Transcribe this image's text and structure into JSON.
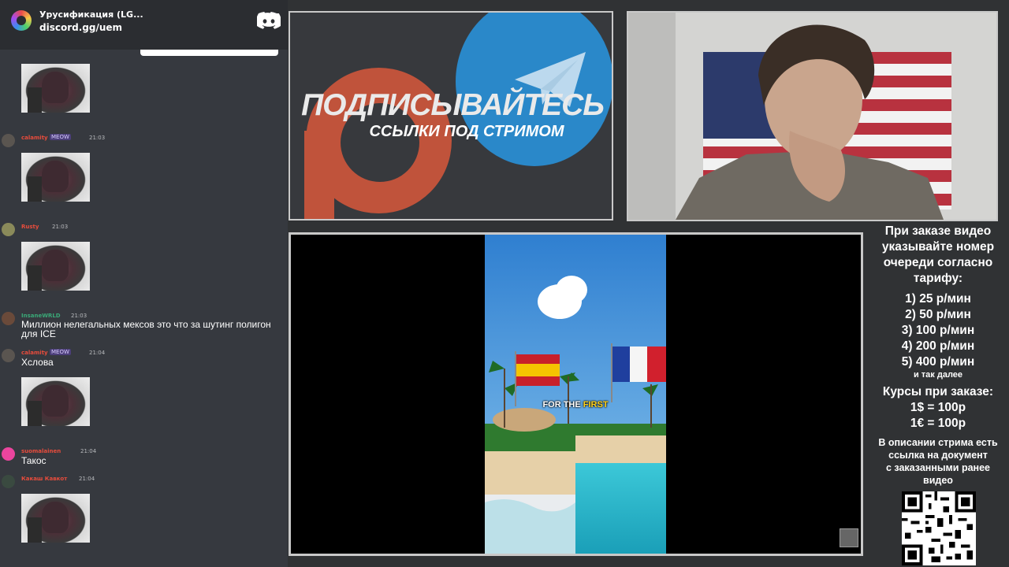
{
  "banner": {
    "title": "Урусификация (LG...",
    "invite": "discord.gg/uem"
  },
  "chat": {
    "messages": [
      {
        "user": "calamity",
        "badge": "MEOW",
        "time": "21:03",
        "text": "",
        "has_image": true,
        "color": "#e74c3c"
      },
      {
        "user": "Rusty",
        "badge": "",
        "time": "21:03",
        "text": "",
        "has_image": true,
        "color": "#e74c3c"
      },
      {
        "user": "InsaneWRLD",
        "badge": "",
        "time": "21:03",
        "text": "Миллион нелегальных мексов это что за шутинг полигон для ICE",
        "has_image": false,
        "color": "#3aa877"
      },
      {
        "user": "calamity",
        "badge": "MEOW",
        "time": "21:04",
        "text": "Хслова",
        "has_image": true,
        "color": "#e74c3c"
      },
      {
        "user": "suomalainen",
        "badge": "",
        "time": "21:04",
        "text": "Такос",
        "has_image": false,
        "color": "#e74c3c"
      },
      {
        "user": "Какаш Кавкот",
        "badge": "",
        "time": "21:04",
        "text": "",
        "has_image": true,
        "color": "#e74c3c"
      }
    ]
  },
  "promo": {
    "title": "ПОДПИСЫВАЙТЕСЬ",
    "subtitle": "ССЫЛКИ ПОД СТРИМОМ"
  },
  "video": {
    "caption_plain": "FOR THE",
    "caption_highlight": "FIRST"
  },
  "info": {
    "heading_lines": [
      "При заказе видео",
      "указывайте номер",
      "очереди согласно",
      "тарифу:"
    ],
    "tariffs": [
      "1) 25 р/мин",
      "2) 50 р/мин",
      "3) 100 р/мин",
      "4) 200 р/мин",
      "5) 400 р/мин"
    ],
    "tariffs_more": "и так далее",
    "rates_heading": "Курсы при заказе:",
    "rates": [
      "1$ = 100р",
      "1€ = 100р"
    ],
    "description_lines": [
      "В описании стрима есть",
      "ссылка на документ",
      "с заказанными ранее",
      "видео"
    ]
  },
  "colors": {
    "patreon": "#c0533b",
    "telegram": "#2a88c9",
    "panel_border": "#c9c9c9",
    "background": "#303234"
  }
}
